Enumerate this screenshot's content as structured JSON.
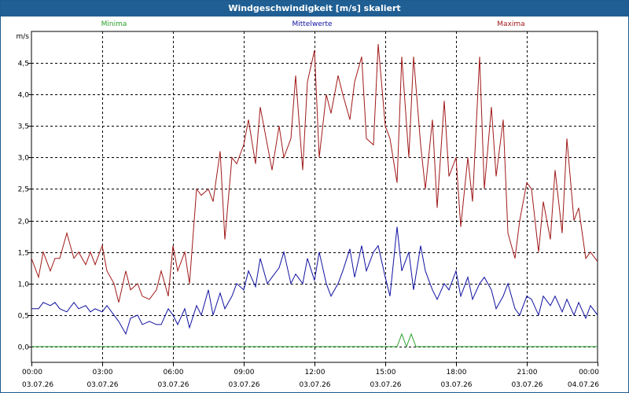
{
  "window_title": "Windgeschwindigkeit [m/s] skaliert",
  "chart_data": {
    "type": "line",
    "unit_label": "m/s",
    "ylim": [
      -0.25,
      5.0
    ],
    "yticks": [
      0.0,
      0.5,
      1.0,
      1.5,
      2.0,
      2.5,
      3.0,
      3.5,
      4.0,
      4.5
    ],
    "ytick_labels": [
      "0,0",
      "0,5",
      "1,0",
      "1,5",
      "2,0",
      "2,5",
      "3,0",
      "3,5",
      "4,0",
      "4,5"
    ],
    "xlim_hours": [
      0,
      24
    ],
    "xticks": [
      {
        "hour": 0,
        "time": "00:00",
        "date": "03.07.26"
      },
      {
        "hour": 3,
        "time": "03:00",
        "date": "03.07.26"
      },
      {
        "hour": 6,
        "time": "06:00",
        "date": "03.07.26"
      },
      {
        "hour": 9,
        "time": "09:00",
        "date": "03.07.26"
      },
      {
        "hour": 12,
        "time": "12:00",
        "date": "03.07.26"
      },
      {
        "hour": 15,
        "time": "15:00",
        "date": "03.07.26"
      },
      {
        "hour": 18,
        "time": "18:00",
        "date": "03.07.26"
      },
      {
        "hour": 21,
        "time": "21:00",
        "date": "03.07.26"
      },
      {
        "hour": 24,
        "time": "00:00",
        "date": "04.07.26"
      }
    ],
    "grid": true,
    "grid_style": "dashed",
    "legend_position": "top",
    "series": [
      {
        "name": "Minima",
        "color": "#2aa02a",
        "x": [
          0,
          15.5,
          15.7,
          15.9,
          16.1,
          16.3,
          24
        ],
        "y": [
          0.0,
          0.0,
          0.2,
          0.0,
          0.2,
          0.0,
          0.0
        ]
      },
      {
        "name": "Mittelwerte",
        "color": "#1010a0",
        "x": [
          0,
          0.3,
          0.5,
          0.8,
          1.0,
          1.2,
          1.5,
          1.8,
          2.0,
          2.3,
          2.5,
          2.7,
          3.0,
          3.2,
          3.5,
          3.7,
          4.0,
          4.2,
          4.5,
          4.7,
          5.0,
          5.3,
          5.5,
          5.8,
          6.0,
          6.2,
          6.5,
          6.7,
          7.0,
          7.2,
          7.5,
          7.7,
          8.0,
          8.2,
          8.5,
          8.7,
          9.0,
          9.2,
          9.5,
          9.7,
          10.0,
          10.2,
          10.5,
          10.7,
          11.0,
          11.2,
          11.5,
          11.7,
          12.0,
          12.2,
          12.5,
          12.7,
          13.0,
          13.2,
          13.5,
          13.7,
          14.0,
          14.2,
          14.5,
          14.7,
          15.0,
          15.2,
          15.5,
          15.7,
          16.0,
          16.2,
          16.5,
          16.7,
          17.0,
          17.2,
          17.5,
          17.7,
          18.0,
          18.2,
          18.5,
          18.7,
          19.0,
          19.2,
          19.5,
          19.7,
          20.0,
          20.2,
          20.5,
          20.7,
          21.0,
          21.2,
          21.5,
          21.7,
          22.0,
          22.2,
          22.5,
          22.7,
          23.0,
          23.2,
          23.5,
          23.7,
          24.0
        ],
        "y": [
          0.6,
          0.6,
          0.7,
          0.65,
          0.7,
          0.6,
          0.55,
          0.7,
          0.6,
          0.65,
          0.55,
          0.6,
          0.55,
          0.65,
          0.5,
          0.4,
          0.2,
          0.45,
          0.5,
          0.35,
          0.4,
          0.35,
          0.35,
          0.6,
          0.5,
          0.35,
          0.6,
          0.3,
          0.65,
          0.5,
          0.9,
          0.5,
          0.85,
          0.6,
          0.8,
          1.0,
          0.9,
          1.2,
          0.95,
          1.4,
          1.0,
          1.1,
          1.25,
          1.5,
          1.0,
          1.15,
          1.0,
          1.4,
          1.05,
          1.5,
          1.0,
          0.8,
          1.0,
          1.2,
          1.55,
          1.1,
          1.6,
          1.2,
          1.5,
          1.6,
          1.1,
          0.8,
          1.9,
          1.2,
          1.5,
          0.9,
          1.6,
          1.2,
          0.9,
          0.75,
          1.0,
          0.9,
          1.2,
          0.8,
          1.1,
          0.75,
          1.0,
          1.1,
          0.9,
          0.6,
          0.8,
          1.0,
          0.6,
          0.5,
          0.8,
          0.75,
          0.5,
          0.8,
          0.65,
          0.8,
          0.55,
          0.75,
          0.5,
          0.7,
          0.45,
          0.65,
          0.5
        ]
      },
      {
        "name": "Maxima",
        "color": "#a01818",
        "x": [
          0,
          0.3,
          0.5,
          0.8,
          1.0,
          1.2,
          1.5,
          1.8,
          2.0,
          2.3,
          2.5,
          2.7,
          3.0,
          3.2,
          3.5,
          3.7,
          4.0,
          4.2,
          4.5,
          4.7,
          5.0,
          5.3,
          5.5,
          5.8,
          6.0,
          6.2,
          6.5,
          6.7,
          7.0,
          7.2,
          7.5,
          7.7,
          8.0,
          8.2,
          8.5,
          8.7,
          9.0,
          9.2,
          9.5,
          9.7,
          10.0,
          10.2,
          10.5,
          10.7,
          11.0,
          11.2,
          11.5,
          11.7,
          12.0,
          12.2,
          12.5,
          12.7,
          13.0,
          13.2,
          13.5,
          13.7,
          14.0,
          14.2,
          14.5,
          14.7,
          15.0,
          15.2,
          15.5,
          15.7,
          16.0,
          16.2,
          16.5,
          16.7,
          17.0,
          17.2,
          17.5,
          17.7,
          18.0,
          18.2,
          18.5,
          18.7,
          19.0,
          19.2,
          19.5,
          19.7,
          20.0,
          20.2,
          20.5,
          20.7,
          21.0,
          21.2,
          21.5,
          21.7,
          22.0,
          22.2,
          22.5,
          22.7,
          23.0,
          23.2,
          23.5,
          23.7,
          24.0
        ],
        "y": [
          1.4,
          1.1,
          1.5,
          1.2,
          1.4,
          1.4,
          1.8,
          1.4,
          1.5,
          1.3,
          1.5,
          1.3,
          1.6,
          1.2,
          1.0,
          0.7,
          1.2,
          0.9,
          1.0,
          0.8,
          0.75,
          0.9,
          1.2,
          0.8,
          1.6,
          1.2,
          1.5,
          1.0,
          2.5,
          2.4,
          2.5,
          2.3,
          3.1,
          1.7,
          3.0,
          2.9,
          3.2,
          3.6,
          2.9,
          3.8,
          3.2,
          2.8,
          3.5,
          3.0,
          3.3,
          4.3,
          2.8,
          4.2,
          4.7,
          3.0,
          4.0,
          3.7,
          4.3,
          4.0,
          3.6,
          4.2,
          4.6,
          3.3,
          3.2,
          4.8,
          3.5,
          3.3,
          2.6,
          4.6,
          3.0,
          4.6,
          3.2,
          2.5,
          3.6,
          2.2,
          3.9,
          2.7,
          3.0,
          1.9,
          3.0,
          2.3,
          4.6,
          2.5,
          3.8,
          2.7,
          3.6,
          1.8,
          1.4,
          2.0,
          2.6,
          2.5,
          1.5,
          2.3,
          1.7,
          2.8,
          1.8,
          3.3,
          2.0,
          2.2,
          1.4,
          1.5,
          1.35
        ]
      }
    ]
  }
}
